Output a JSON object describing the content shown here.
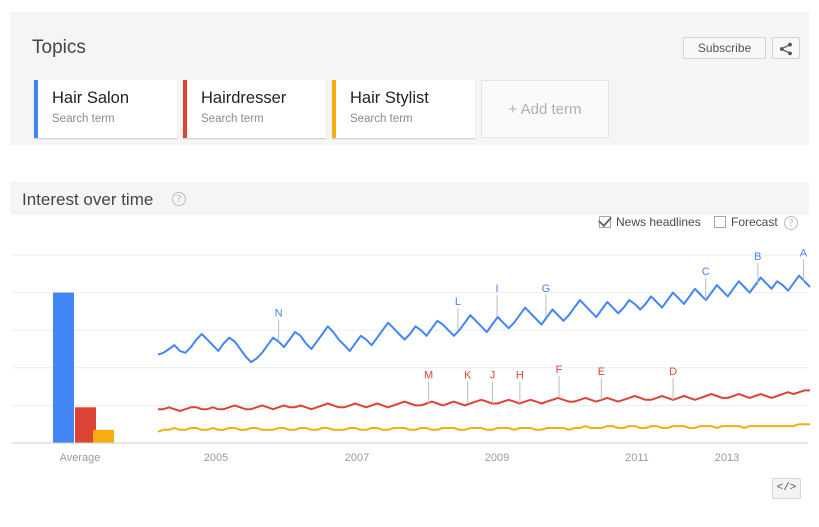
{
  "topics": {
    "title": "Topics",
    "subscribe_label": "Subscribe",
    "share_icon": "share-icon",
    "add_term_label": "+ Add term",
    "terms": [
      {
        "name": "Hair Salon",
        "type": "Search term",
        "color": "#4285f4"
      },
      {
        "name": "Hairdresser",
        "type": "Search term",
        "color": "#dc4436"
      },
      {
        "name": "Hair Stylist",
        "type": "Search term",
        "color": "#f5ae12"
      }
    ]
  },
  "interest_over_time": {
    "title": "Interest over time",
    "help_icon": "help-icon",
    "news_headlines_label": "News headlines",
    "news_headlines_checked": true,
    "forecast_label": "Forecast",
    "forecast_checked": false,
    "forecast_help_icon": "help-icon",
    "embed_label": "</>"
  },
  "chart_data": {
    "type": "line",
    "title": "Interest over time",
    "xlabel": "",
    "ylabel": "",
    "ylim": [
      0,
      100
    ],
    "grid": true,
    "legend": "none",
    "tick_labels": [
      "Average",
      "2005",
      "2007",
      "2009",
      "2011",
      "2013"
    ],
    "average_bars": {
      "type": "bar",
      "categories": [
        "Hair Salon",
        "Hairdresser",
        "Hair Stylist"
      ],
      "values": [
        80,
        19,
        7
      ],
      "colors": [
        "#4285f4",
        "#dc4436",
        "#f5ae12"
      ],
      "axis_label": "Average"
    },
    "series": [
      {
        "name": "Hair Salon",
        "color": "#4285f4",
        "values": [
          47,
          48,
          50,
          52,
          49,
          48,
          51,
          55,
          58,
          55,
          52,
          49,
          53,
          56,
          54,
          50,
          46,
          43,
          45,
          48,
          52,
          56,
          54,
          51,
          55,
          59,
          57,
          53,
          50,
          54,
          58,
          62,
          59,
          55,
          52,
          49,
          53,
          57,
          55,
          52,
          56,
          60,
          64,
          61,
          58,
          55,
          58,
          62,
          60,
          57,
          61,
          65,
          63,
          60,
          57,
          60,
          64,
          68,
          65,
          62,
          59,
          63,
          67,
          64,
          61,
          64,
          68,
          72,
          69,
          66,
          63,
          67,
          71,
          68,
          65,
          68,
          72,
          76,
          73,
          70,
          67,
          71,
          75,
          72,
          69,
          72,
          76,
          74,
          71,
          74,
          78,
          75,
          72,
          76,
          80,
          77,
          74,
          78,
          82,
          79,
          76,
          80,
          84,
          81,
          78,
          82,
          86,
          83,
          80,
          84,
          88,
          85,
          82,
          86,
          84,
          81,
          85,
          89,
          86,
          83
        ]
      },
      {
        "name": "Hairdresser",
        "color": "#dc4436",
        "values": [
          18,
          18,
          19,
          18,
          17,
          18,
          19,
          19,
          18,
          18,
          19,
          18,
          18,
          19,
          20,
          19,
          18,
          18,
          19,
          20,
          19,
          18,
          19,
          20,
          19,
          19,
          20,
          19,
          18,
          19,
          20,
          21,
          20,
          19,
          19,
          20,
          21,
          20,
          19,
          20,
          21,
          20,
          19,
          20,
          21,
          22,
          21,
          20,
          20,
          21,
          22,
          21,
          20,
          21,
          22,
          21,
          20,
          21,
          22,
          23,
          22,
          21,
          21,
          22,
          23,
          22,
          21,
          22,
          23,
          22,
          21,
          22,
          23,
          24,
          23,
          22,
          22,
          23,
          24,
          23,
          22,
          23,
          24,
          23,
          22,
          23,
          24,
          25,
          24,
          23,
          23,
          24,
          25,
          24,
          23,
          24,
          25,
          24,
          23,
          24,
          25,
          26,
          25,
          24,
          24,
          25,
          26,
          25,
          24,
          25,
          26,
          25,
          24,
          25,
          26,
          27,
          26,
          27,
          28,
          28
        ]
      },
      {
        "name": "Hair Stylist",
        "color": "#f5ae12",
        "values": [
          6,
          7,
          7,
          8,
          7,
          7,
          8,
          8,
          7,
          7,
          8,
          7,
          7,
          8,
          8,
          7,
          7,
          8,
          8,
          7,
          7,
          7,
          8,
          8,
          7,
          7,
          8,
          8,
          7,
          7,
          8,
          8,
          7,
          7,
          7,
          8,
          8,
          7,
          7,
          8,
          8,
          7,
          7,
          8,
          8,
          8,
          7,
          7,
          8,
          8,
          7,
          7,
          8,
          8,
          8,
          7,
          7,
          8,
          8,
          8,
          7,
          7,
          8,
          8,
          8,
          7,
          8,
          8,
          8,
          7,
          7,
          8,
          8,
          8,
          8,
          7,
          8,
          8,
          9,
          8,
          8,
          8,
          9,
          9,
          8,
          8,
          9,
          9,
          8,
          8,
          9,
          9,
          8,
          8,
          9,
          9,
          9,
          8,
          8,
          9,
          9,
          9,
          8,
          9,
          9,
          9,
          9,
          8,
          9,
          9,
          9,
          9,
          9,
          9,
          9,
          9,
          9,
          10,
          10,
          10
        ]
      }
    ],
    "news_markers_blue": [
      {
        "label": "N",
        "x_pct": 18.5
      },
      {
        "label": "L",
        "x_pct": 46.0
      },
      {
        "label": "I",
        "x_pct": 52.0
      },
      {
        "label": "G",
        "x_pct": 59.5
      },
      {
        "label": "C",
        "x_pct": 84.0
      },
      {
        "label": "B",
        "x_pct": 92.0
      },
      {
        "label": "A",
        "x_pct": 99.0
      }
    ],
    "news_markers_red": [
      {
        "label": "M",
        "x_pct": 41.5
      },
      {
        "label": "K",
        "x_pct": 47.5
      },
      {
        "label": "J",
        "x_pct": 51.3
      },
      {
        "label": "H",
        "x_pct": 55.5
      },
      {
        "label": "F",
        "x_pct": 61.5
      },
      {
        "label": "E",
        "x_pct": 68.0
      },
      {
        "label": "D",
        "x_pct": 79.0
      }
    ]
  }
}
